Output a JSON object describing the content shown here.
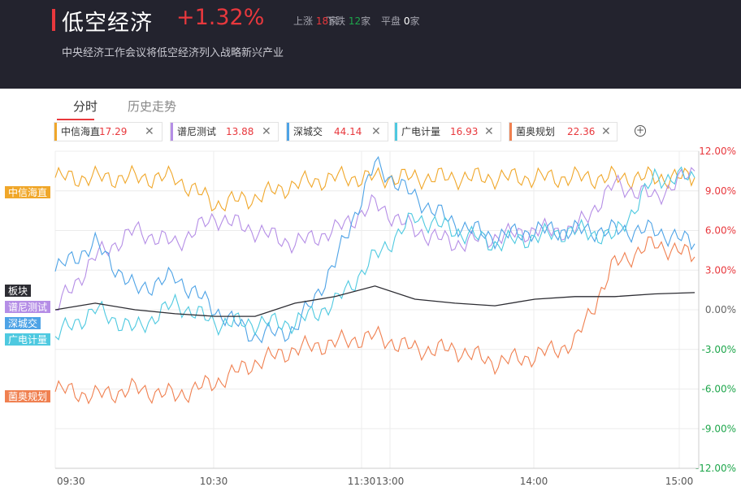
{
  "header": {
    "title": "低空经济",
    "change": "+1.32%",
    "up_label": "上涨",
    "up_count": "18",
    "down_label": "下跌",
    "down_count": "12",
    "flat_label": "平盘",
    "flat_count": "0",
    "unit": "家",
    "subtitle": "中央经济工作会议将低空经济列入战略新兴产业"
  },
  "tabs": [
    {
      "label": "分时",
      "active": true
    },
    {
      "label": "历史走势",
      "active": false
    }
  ],
  "chips": [
    {
      "name": "中信海直",
      "price": "17.29",
      "color": "#f0a72a"
    },
    {
      "name": "谱尼测试",
      "price": "13.88",
      "color": "#b58ee6"
    },
    {
      "name": "深城交",
      "price": "44.14",
      "color": "#4ea3e6"
    },
    {
      "name": "广电计量",
      "price": "16.93",
      "color": "#4ec9e0"
    },
    {
      "name": "菌奥规划",
      "price": "22.36",
      "color": "#f08050"
    }
  ],
  "close_icon": "close-icon",
  "add_icon": "plus-circle-icon",
  "chart_data": {
    "type": "line",
    "y_unit": "%",
    "ylim": [
      -12,
      12
    ],
    "y_ticks": [
      "12.00%",
      "9.00%",
      "6.00%",
      "3.00%",
      "0.00%",
      "-3.00%",
      "-6.00%",
      "-9.00%",
      "-12.00%"
    ],
    "x_ticks": [
      "09:30",
      "10:30",
      "11:30",
      "13:00",
      "14:00",
      "15:00"
    ],
    "x": [
      "09:30",
      "09:45",
      "10:00",
      "10:15",
      "10:30",
      "10:45",
      "11:00",
      "11:15",
      "11:30",
      "13:15",
      "13:30",
      "13:45",
      "14:00",
      "14:15",
      "14:30",
      "14:45",
      "15:00"
    ],
    "grid": true,
    "series": [
      {
        "name": "中信海直",
        "color": "#f0a72a",
        "label_color": "#f0a72a",
        "values": [
          10.0,
          10.0,
          10.0,
          10.0,
          8.0,
          8.5,
          9.5,
          10.0,
          10.0,
          10.0,
          10.0,
          10.0,
          10.0,
          10.0,
          10.0,
          10.0,
          10.0
        ]
      },
      {
        "name": "谱尼测试",
        "color": "#b58ee6",
        "label_color": "#b58ee6",
        "values": [
          0.0,
          4.0,
          6.0,
          5.0,
          7.0,
          6.0,
          5.0,
          6.0,
          8.0,
          6.0,
          5.0,
          5.5,
          6.0,
          6.0,
          9.5,
          8.5,
          10.5
        ]
      },
      {
        "name": "深城交",
        "color": "#4ea3e6",
        "label_color": "#4ea3e6",
        "values": [
          3.0,
          5.0,
          1.5,
          2.5,
          0.0,
          -2.0,
          -1.5,
          3.5,
          11.0,
          8.5,
          6.5,
          5.5,
          6.0,
          6.0,
          6.0,
          6.0,
          5.0
        ]
      },
      {
        "name": "广电计量",
        "color": "#4ec9e0",
        "label_color": "#4ec9e0",
        "values": [
          -2.0,
          0.0,
          -1.5,
          0.5,
          -1.0,
          -1.0,
          -1.0,
          0.5,
          4.0,
          7.0,
          6.0,
          5.0,
          5.5,
          6.0,
          5.5,
          10.0,
          10.0
        ]
      },
      {
        "name": "菌奥规划",
        "color": "#f08050",
        "label_color": "#f08050",
        "values": [
          -6.0,
          -6.5,
          -6.0,
          -6.5,
          -5.5,
          -4.0,
          -3.0,
          -2.5,
          -2.0,
          -3.0,
          -3.0,
          -4.0,
          -3.5,
          -2.5,
          3.5,
          5.0,
          4.0
        ]
      },
      {
        "name": "板块",
        "color": "#2d2d33",
        "label_color": "#2d2d33",
        "values": [
          0.0,
          0.5,
          0.0,
          -0.3,
          -0.5,
          -0.5,
          0.5,
          1.0,
          1.8,
          0.8,
          0.5,
          0.3,
          0.8,
          1.0,
          1.0,
          1.2,
          1.3
        ]
      }
    ]
  }
}
